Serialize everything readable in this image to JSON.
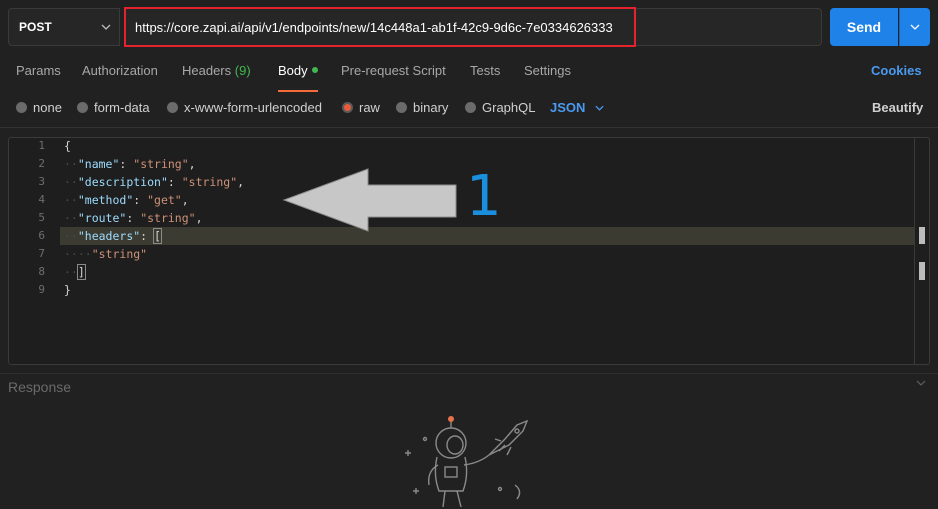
{
  "request": {
    "method": "POST",
    "url": "https://core.zapi.ai/api/v1/endpoints/new/14c448a1-ab1f-42c9-9d6c-7e0334626333",
    "send_label": "Send"
  },
  "tabs": {
    "params": "Params",
    "authorization": "Authorization",
    "headers": "Headers",
    "headers_count": "(9)",
    "body": "Body",
    "prerequest": "Pre-request Script",
    "tests": "Tests",
    "settings": "Settings",
    "cookies": "Cookies"
  },
  "body_types": {
    "none": "none",
    "form_data": "form-data",
    "urlencoded": "x-www-form-urlencoded",
    "raw": "raw",
    "binary": "binary",
    "graphql": "GraphQL",
    "selected": "raw",
    "format": "JSON",
    "beautify": "Beautify"
  },
  "editor": {
    "line_numbers": [
      "1",
      "2",
      "3",
      "4",
      "5",
      "6",
      "7",
      "8",
      "9"
    ],
    "lines": [
      [
        "{"
      ],
      [
        "\"name\"",
        ": ",
        "\"string\"",
        ","
      ],
      [
        "\"description\"",
        ": ",
        "\"string\"",
        ","
      ],
      [
        "\"method\"",
        ": ",
        "\"get\"",
        ","
      ],
      [
        "\"route\"",
        ": ",
        "\"string\"",
        ","
      ],
      [
        "\"headers\"",
        ": ",
        "["
      ],
      [
        "\"string\""
      ],
      [
        "]"
      ],
      [
        "}"
      ]
    ],
    "highlighted_line": "6"
  },
  "annotation": {
    "label": "1",
    "color": "#1a8fde"
  },
  "response": {
    "label": "Response"
  },
  "colors": {
    "accent_blue": "#1f82e8",
    "url_highlight": "#e5222e",
    "active_tab_underline": "#f26b3a",
    "status_green": "#3fb950"
  },
  "icons": [
    "chevron-down-icon",
    "arrow-left-annotation",
    "astronaut-illustration"
  ]
}
